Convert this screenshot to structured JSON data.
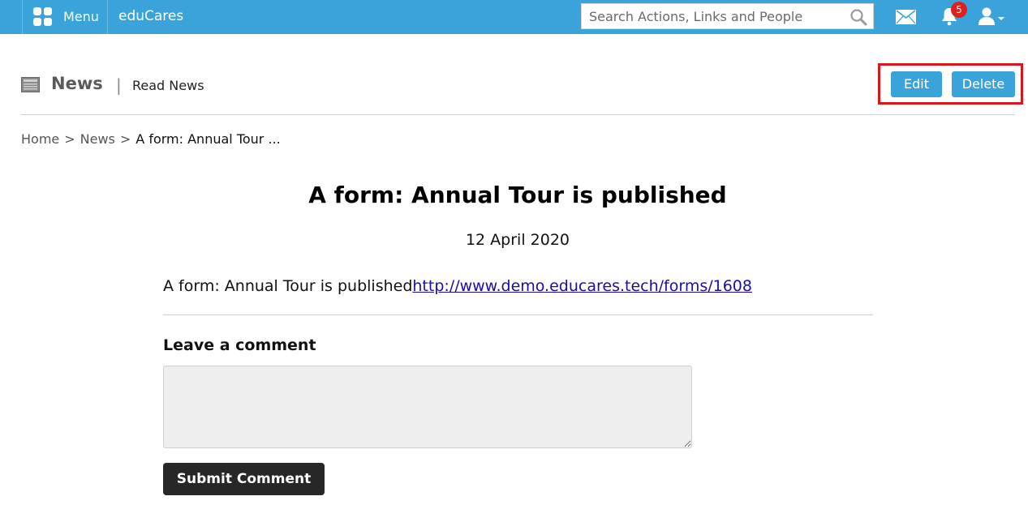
{
  "topbar": {
    "menu_label": "Menu",
    "brand": "eduCares",
    "search": {
      "placeholder": "Search Actions, Links and People"
    },
    "notifications_count": "5",
    "icons": [
      "grid-icon",
      "search-icon",
      "mail-icon",
      "bell-icon",
      "user-icon",
      "chevron-down-icon"
    ],
    "color": "#3aa3d9"
  },
  "header": {
    "title": "News",
    "separator": "|",
    "subtitle": "Read News",
    "icon": "newspaper-icon",
    "actions": {
      "edit_label": "Edit",
      "delete_label": "Delete"
    },
    "highlight_color": "#d9161e"
  },
  "breadcrumb": {
    "items": [
      "Home",
      "News",
      "A form: Annual Tour ..."
    ],
    "separator": ">"
  },
  "article": {
    "title": "A form: Annual Tour is published",
    "date": "12 April 2020",
    "body_text": "A form: Annual Tour is published",
    "link_text": "http://www.demo.educares.tech/forms/1608"
  },
  "comments": {
    "heading": "Leave a comment",
    "textarea_value": "",
    "submit_label": "Submit Comment"
  }
}
